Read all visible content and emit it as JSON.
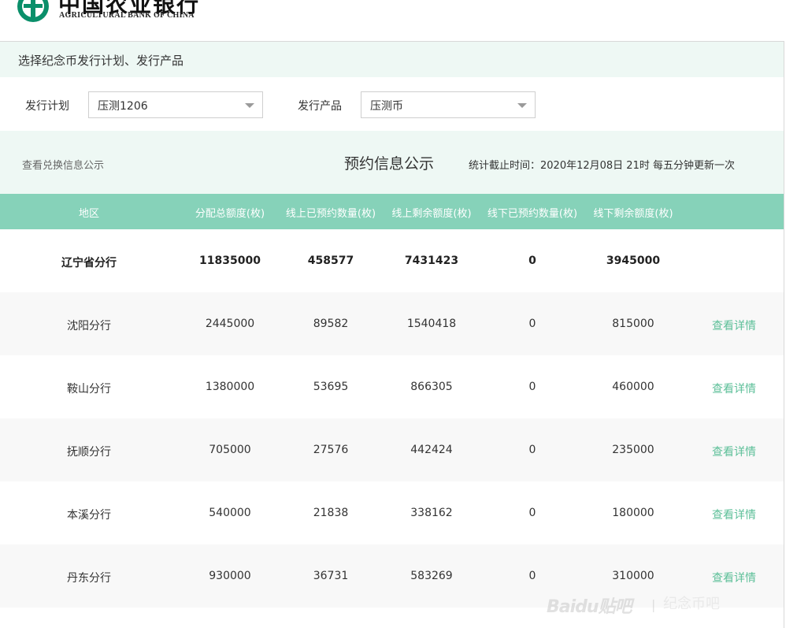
{
  "logo": {
    "bank_name_cn": "中国农业银行",
    "bank_name_en": "AGRICULTURAL BANK OF CHINA",
    "brand_color": "#0a8f6a"
  },
  "select_section": {
    "title": "选择纪念币发行计划、发行产品"
  },
  "filters": {
    "plan_label": "发行计划",
    "plan_value": "压测1206",
    "product_label": "发行产品",
    "product_value": "压测币"
  },
  "info": {
    "link_text": "查看兑换信息公示",
    "title": "预约信息公示",
    "stat_text": "统计截止时间：2020年12月08日 21时 每五分钟更新一次"
  },
  "table": {
    "columns": [
      "地区",
      "分配总额度(枚)",
      "线上已预约数量(枚)",
      "线上剩余额度(枚)",
      "线下已预约数量(枚)",
      "线下剩余额度(枚)"
    ],
    "header_color": "#86d2b9",
    "link_color": "#5cbf98",
    "rows": [
      {
        "region": "辽宁省分行",
        "total": "11835000",
        "online_booked": "458577",
        "online_remain": "7431423",
        "offline_booked": "0",
        "offline_remain": "3945000",
        "detail": ""
      },
      {
        "region": "沈阳分行",
        "total": "2445000",
        "online_booked": "89582",
        "online_remain": "1540418",
        "offline_booked": "0",
        "offline_remain": "815000",
        "detail": "查看详情"
      },
      {
        "region": "鞍山分行",
        "total": "1380000",
        "online_booked": "53695",
        "online_remain": "866305",
        "offline_booked": "0",
        "offline_remain": "460000",
        "detail": "查看详情"
      },
      {
        "region": "抚顺分行",
        "total": "705000",
        "online_booked": "27576",
        "online_remain": "442424",
        "offline_booked": "0",
        "offline_remain": "235000",
        "detail": "查看详情"
      },
      {
        "region": "本溪分行",
        "total": "540000",
        "online_booked": "21838",
        "online_remain": "338162",
        "offline_booked": "0",
        "offline_remain": "180000",
        "detail": "查看详情"
      },
      {
        "region": "丹东分行",
        "total": "930000",
        "online_booked": "36731",
        "online_remain": "583269",
        "offline_booked": "0",
        "offline_remain": "310000",
        "detail": "查看详情"
      }
    ]
  },
  "watermark": {
    "brand": "Bai",
    "paw": "du",
    "tieba": "贴吧",
    "sub": "纪念币吧"
  }
}
